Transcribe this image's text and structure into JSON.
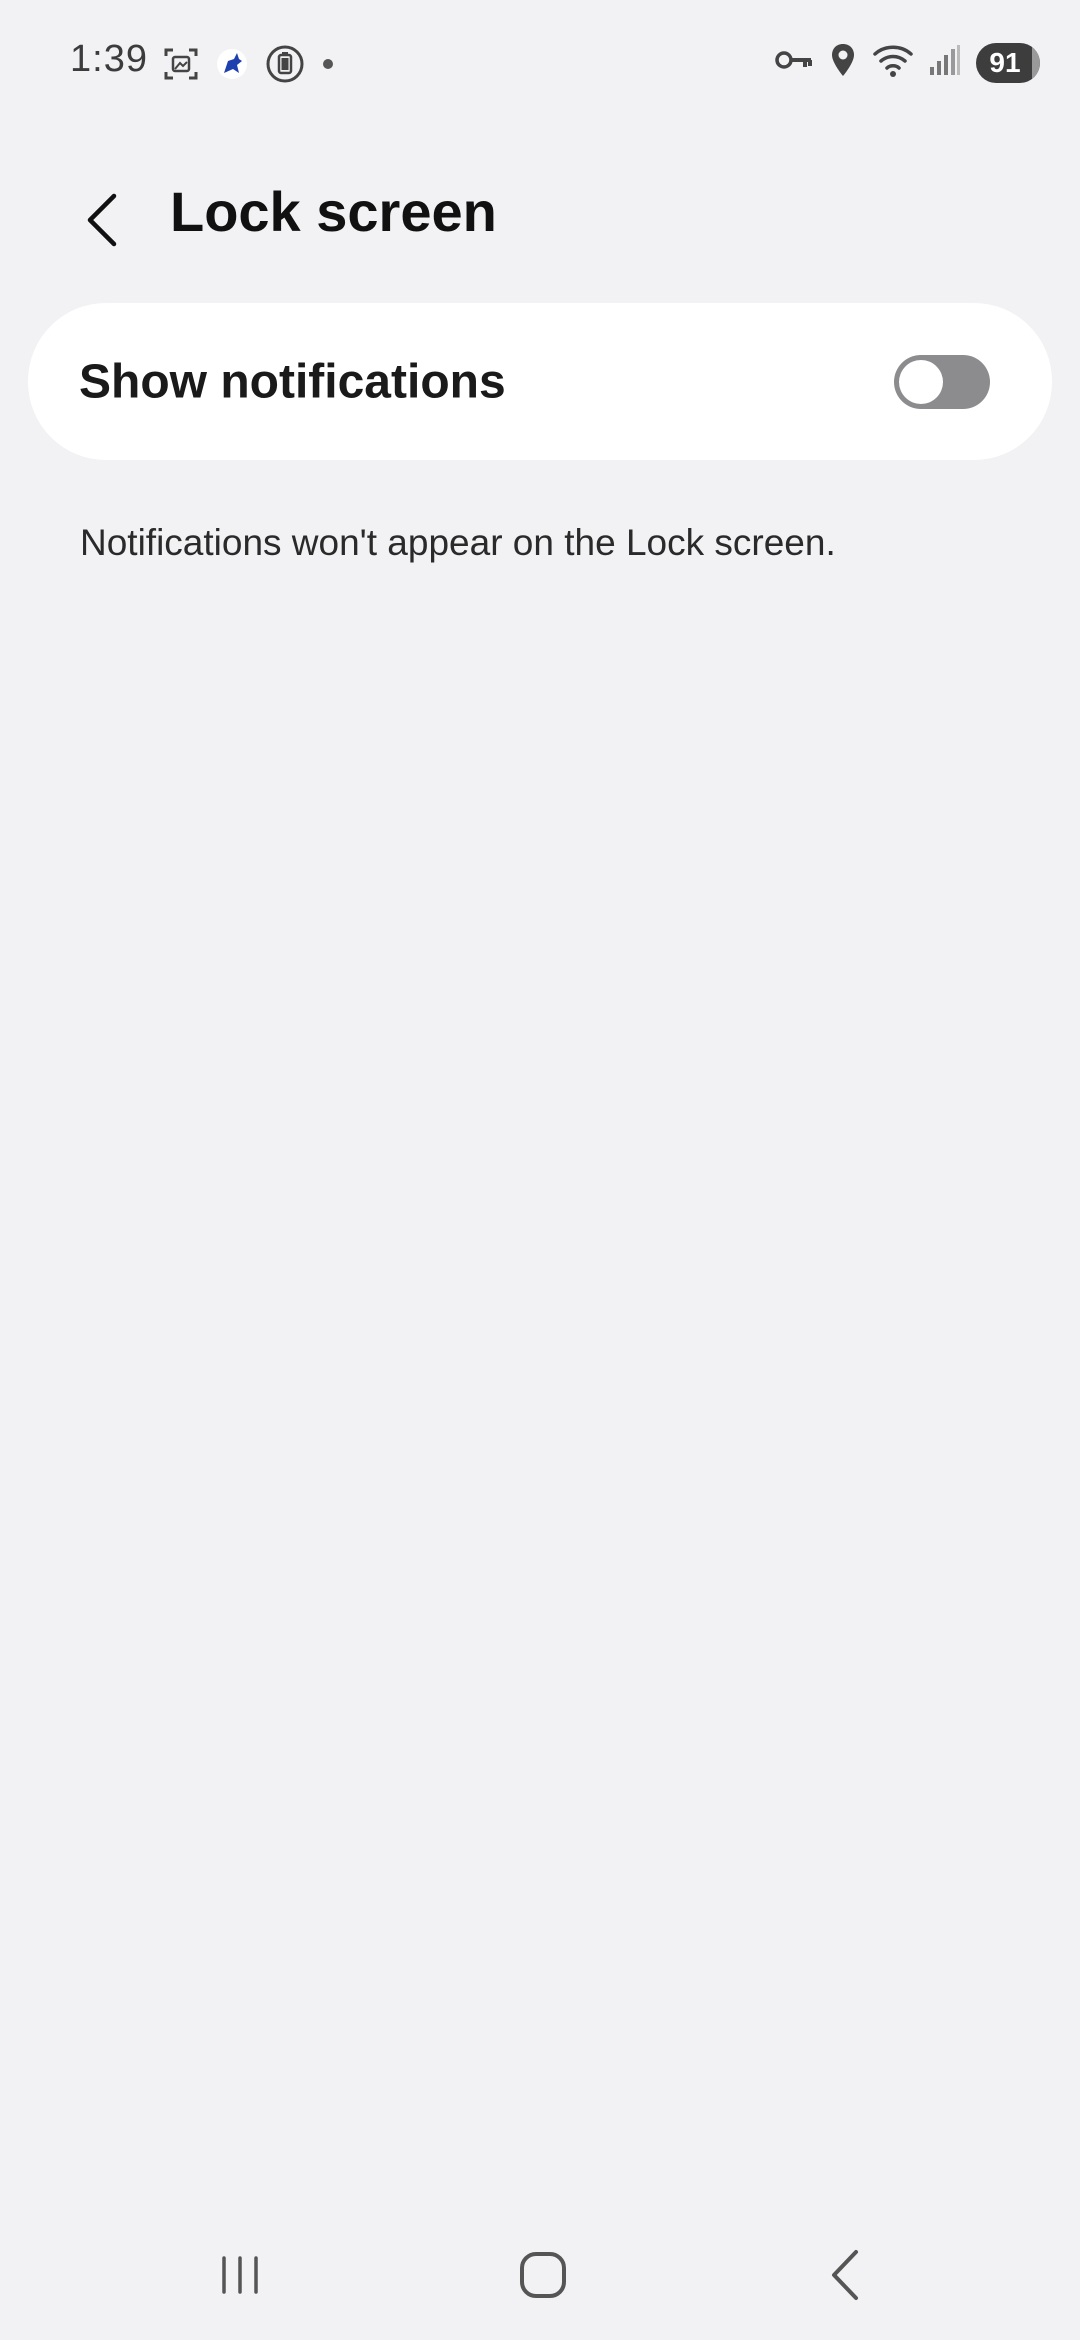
{
  "status_bar": {
    "time": "1:39",
    "battery_level": "91",
    "left_icons": [
      "screenshot-icon",
      "app-notification-icon",
      "battery-saver-icon",
      "dot-icon"
    ],
    "right_icons": [
      "vpn-key-icon",
      "location-icon",
      "wifi-icon",
      "signal-icon"
    ]
  },
  "header": {
    "title": "Lock screen"
  },
  "setting": {
    "label": "Show notifications",
    "toggle_on": false
  },
  "description": "Notifications won't appear on the Lock screen.",
  "colors": {
    "background": "#f2f2f4",
    "card": "#ffffff",
    "toggle_off": "#8c8c8e"
  }
}
